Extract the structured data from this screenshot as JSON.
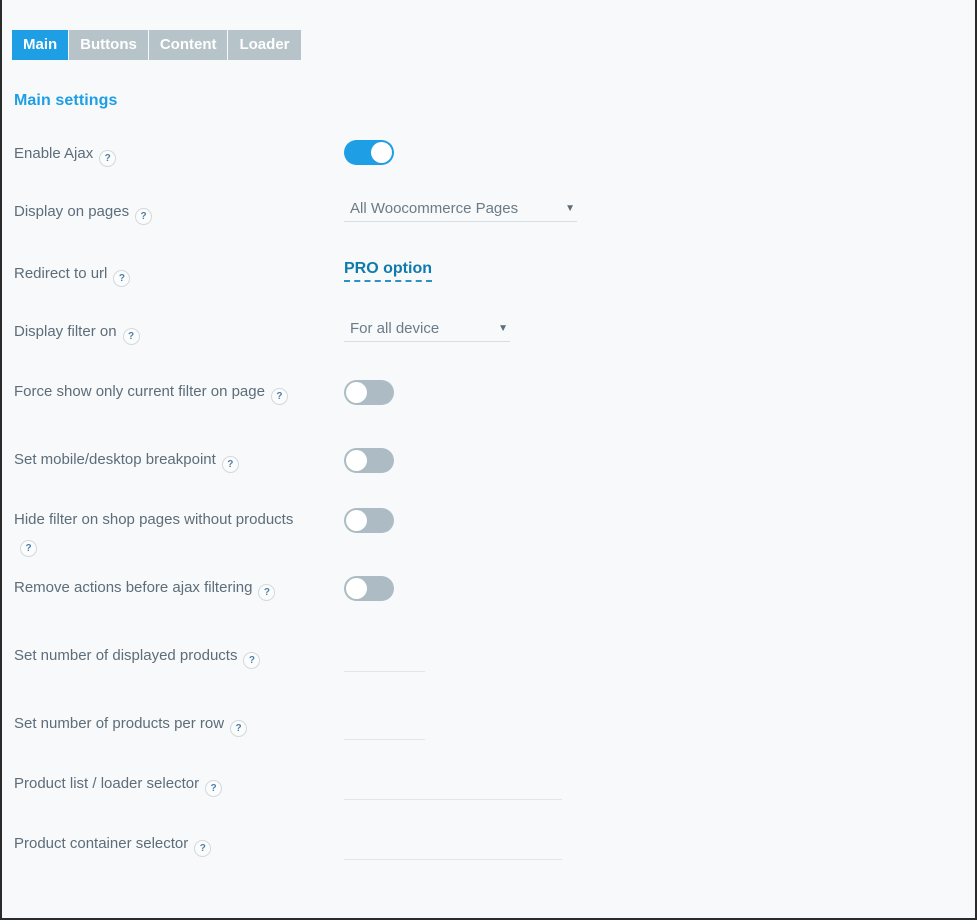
{
  "window": {
    "background_color": "#f7f9fa",
    "border_color": "#2b2b2b"
  },
  "theme": {
    "accent": "#1e9ee5",
    "tab_inactive": "#b6c3c9",
    "label_color": "#5d6d7a",
    "toggle_off": "#adbcc4",
    "pro_link_color": "#0f7bac"
  },
  "tabs": [
    {
      "label": "Main",
      "active": true
    },
    {
      "label": "Buttons",
      "active": false
    },
    {
      "label": "Content",
      "active": false
    },
    {
      "label": "Loader",
      "active": false
    }
  ],
  "section": {
    "title": "Main settings"
  },
  "help_icon": "?",
  "caret_icon": "▼",
  "rows": [
    {
      "label": "Enable Ajax",
      "control": "toggle",
      "value": "on"
    },
    {
      "label": "Display on pages",
      "control": "select",
      "value": "All Woocommerce Pages"
    },
    {
      "label": "Redirect to url",
      "control": "pro",
      "value": "PRO option"
    },
    {
      "label": "Display filter on",
      "control": "select",
      "value": "For all device"
    },
    {
      "label": "Force show only current filter on page",
      "control": "toggle",
      "value": "off"
    },
    {
      "label": "Set mobile/desktop breakpoint",
      "control": "toggle",
      "value": "off"
    },
    {
      "label": "Hide filter on shop pages without products",
      "control": "toggle",
      "value": "off"
    },
    {
      "label": "Remove actions before ajax filtering",
      "control": "toggle",
      "value": "off"
    },
    {
      "label": "Set number of displayed products",
      "control": "input-short",
      "value": "",
      "placeholder": ""
    },
    {
      "label": "Set number of products per row",
      "control": "input-short",
      "value": "",
      "placeholder": ""
    },
    {
      "label": "Product list / loader selector",
      "control": "input-wide",
      "value": "",
      "placeholder": ""
    },
    {
      "label": "Product container selector",
      "control": "input-wide",
      "value": "",
      "placeholder": ""
    }
  ]
}
